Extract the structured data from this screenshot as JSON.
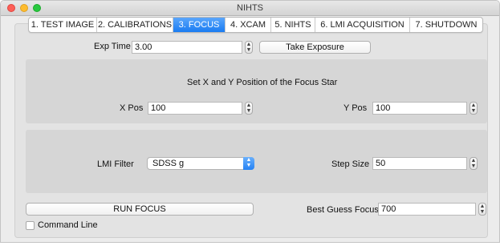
{
  "window": {
    "title": "NIHTS",
    "colors": {
      "close": "#fd5f57",
      "minimize": "#febc2e",
      "zoom": "#28c840",
      "accent": "#1a7cf2"
    }
  },
  "tabs": [
    {
      "label": "1. TEST IMAGE",
      "active": false
    },
    {
      "label": "2. CALIBRATIONS",
      "active": false
    },
    {
      "label": "3. FOCUS",
      "active": true
    },
    {
      "label": "4. XCAM",
      "active": false
    },
    {
      "label": "5. NIHTS",
      "active": false
    },
    {
      "label": "6. LMI ACQUISITION",
      "active": false
    },
    {
      "label": "7. SHUTDOWN",
      "active": false
    }
  ],
  "exposure": {
    "exp_time_label": "Exp Time",
    "exp_time_value": "3.00",
    "take_exposure_label": "Take Exposure"
  },
  "focus_star": {
    "heading": "Set X and Y Position of the Focus Star",
    "x_label": "X Pos",
    "x_value": "100",
    "y_label": "Y Pos",
    "y_value": "100"
  },
  "settings": {
    "filter_label": "LMI Filter",
    "filter_value": "SDSS g",
    "step_label": "Step Size",
    "step_value": "50"
  },
  "run": {
    "run_focus_label": "RUN FOCUS",
    "best_guess_label": "Best Guess Focus",
    "best_guess_value": "700"
  },
  "command_line": {
    "label": "Command Line",
    "checked": false
  }
}
